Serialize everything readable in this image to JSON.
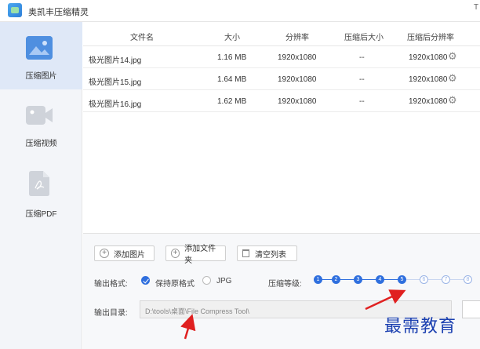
{
  "app": {
    "title": "奥凯丰压缩精灵",
    "right_glyph": "T"
  },
  "sidebar": {
    "items": [
      {
        "label": "压缩图片",
        "active": true,
        "icon": "image-icon"
      },
      {
        "label": "压缩视频",
        "active": false,
        "icon": "video-icon"
      },
      {
        "label": "压缩PDF",
        "active": false,
        "icon": "pdf-icon"
      }
    ]
  },
  "table": {
    "headers": [
      "文件名",
      "大小",
      "分辨率",
      "压缩后大小",
      "压缩后分辨率"
    ],
    "rows": [
      {
        "name": "极光图片14.jpg",
        "size": "1.16 MB",
        "resolution": "1920x1080",
        "compressed_size": "--",
        "compressed_resolution": "1920x1080"
      },
      {
        "name": "极光图片15.jpg",
        "size": "1.64 MB",
        "resolution": "1920x1080",
        "compressed_size": "--",
        "compressed_resolution": "1920x1080"
      },
      {
        "name": "极光图片16.jpg",
        "size": "1.62 MB",
        "resolution": "1920x1080",
        "compressed_size": "--",
        "compressed_resolution": "1920x1080"
      }
    ]
  },
  "actions": {
    "add_image": "添加图片",
    "add_folder": "添加文件夹",
    "clear_list": "清空列表"
  },
  "format": {
    "label": "输出格式:",
    "keep_original": "保持原格式",
    "jpg": "JPG",
    "selected": "keep_original"
  },
  "level": {
    "label": "压缩等级:",
    "steps": [
      "1",
      "2",
      "3",
      "4",
      "5",
      "6",
      "7",
      "8"
    ],
    "current": 5
  },
  "output": {
    "label": "输出目录:",
    "path": "D:\\tools\\桌面\\File Compress Tool\\"
  },
  "watermark": "最需教育",
  "colors": {
    "accent": "#2f6fde",
    "arrow": "#e02020",
    "sidebar_active": "#dfe8f7"
  }
}
